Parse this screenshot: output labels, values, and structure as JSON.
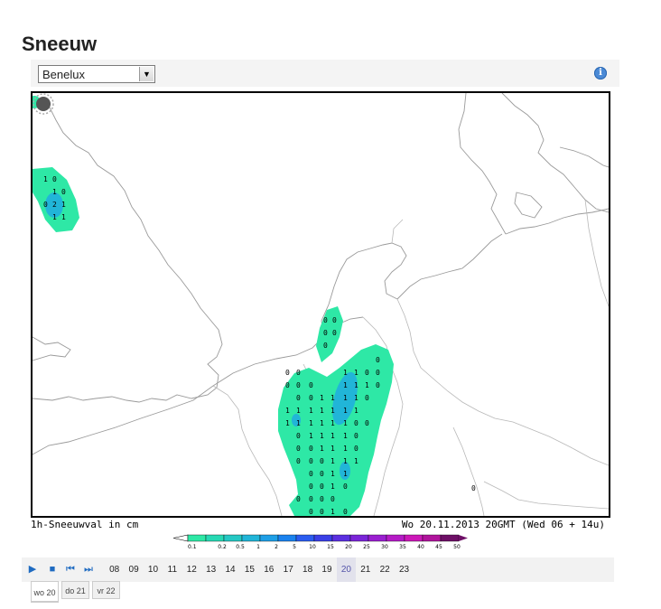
{
  "page": {
    "title": "Sneeuw"
  },
  "toolbar": {
    "region_selected": "Benelux",
    "info_icon": "info-icon"
  },
  "map": {
    "caption_left": "1h-Sneeuwval in cm",
    "caption_right": "Wo 20.11.2013 20GMT (Wed 06 + 14u)",
    "loading_icon": "spinner-icon"
  },
  "legend": {
    "labels": [
      "0.1",
      "0.2",
      "0.5",
      "1",
      "2",
      "5",
      "10",
      "15",
      "20",
      "25",
      "30",
      "35",
      "40",
      "45",
      "50"
    ],
    "colors": [
      "#2ee8a6",
      "#27d9b4",
      "#25c8c4",
      "#21b5d8",
      "#1e9fe6",
      "#1a82ee",
      "#2b5cf0",
      "#3a3fe6",
      "#5b2fe0",
      "#7a25d8",
      "#9a1fd0",
      "#b51bc6",
      "#cc18b8",
      "#b0149c",
      "#6e0f66"
    ]
  },
  "playback": {
    "icons": [
      "play-icon",
      "stop-icon",
      "skip-back-icon",
      "skip-forward-icon"
    ],
    "hours": [
      "08",
      "09",
      "10",
      "11",
      "12",
      "13",
      "14",
      "15",
      "16",
      "17",
      "18",
      "19",
      "20",
      "21",
      "22",
      "23"
    ],
    "active_hour": "20"
  },
  "days": [
    {
      "label": "wo 20",
      "active": true
    },
    {
      "label": "do 21",
      "active": false
    },
    {
      "label": "vr 22",
      "active": false
    }
  ]
}
